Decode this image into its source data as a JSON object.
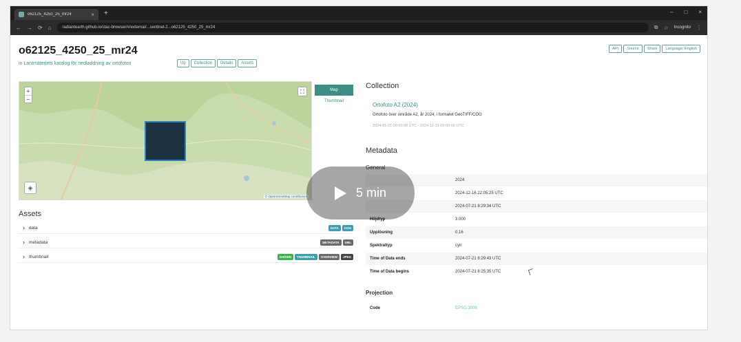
{
  "browser": {
    "tab_title": "o62125_4250_25_mr24",
    "url": "radiantearth.github.io/stac-browser/#/external/...sentinel-2...o62125_4250_25_mr24",
    "incognito_label": "Incognito"
  },
  "page": {
    "title": "o62125_4250_25_mr24",
    "subtitle": "in Lantmäteriets katalog för nedladdning av ortofoton",
    "chips": [
      "Up",
      "Collection",
      "Details",
      "Assets"
    ],
    "top_actions": [
      "API",
      "Source",
      "Share",
      "Language: English"
    ]
  },
  "map": {
    "zoom_in": "+",
    "zoom_out": "−",
    "view_tabs": [
      "Map",
      "Thumbnail"
    ],
    "attribution": "© OpenStreetMap contributors"
  },
  "assets": {
    "heading": "Assets",
    "items": [
      {
        "name": "data",
        "badges": [
          {
            "label": "DATA",
            "color": "#3d9fae"
          },
          {
            "label": "COG",
            "color": "#3d9fae"
          }
        ]
      },
      {
        "name": "metadata",
        "badges": [
          {
            "label": "METADATA",
            "color": "#6a6a6a"
          },
          {
            "label": "XML",
            "color": "#6a6a6a"
          }
        ]
      },
      {
        "name": "thumbnail",
        "badges": [
          {
            "label": "SHOWN",
            "color": "#3ab54a"
          },
          {
            "label": "THUMBNAIL",
            "color": "#3d9fae"
          },
          {
            "label": "OVERVIEW",
            "color": "#6a6a6a"
          },
          {
            "label": "JPEG",
            "color": "#444444"
          }
        ]
      }
    ]
  },
  "collection": {
    "heading": "Collection",
    "link": "Ortofoto A2 (2024)",
    "description": "Ortofoto över område A2, år 2024, i formatet GeoTIFF/COG",
    "dates": "2024-01-01 00:00:00 UTC - 2024-12-31 00:00:00 UTC"
  },
  "metadata": {
    "heading": "Metadata",
    "general": "General",
    "rows": [
      {
        "key": "",
        "value": "2024",
        "shade": true
      },
      {
        "key": "",
        "value": "2024-12-16 22:05:25 UTC",
        "shade": false
      },
      {
        "key": "",
        "value": "2024-07-21 8:29:34 UTC",
        "shade": true
      },
      {
        "key": "Höjdtyp",
        "value": "3.000",
        "shade": false
      },
      {
        "key": "Upplösning",
        "value": "0.16",
        "shade": true
      },
      {
        "key": "Spektraltyp",
        "value": "cyir",
        "shade": false
      },
      {
        "key": "Time of Data ends",
        "value": "2024-07-21 8:29:43 UTC",
        "shade": true
      },
      {
        "key": "Time of Data begins",
        "value": "2024-07-21 8:25:35 UTC",
        "shade": false
      }
    ],
    "projection_heading": "Projection",
    "code_key": "Code",
    "code_value": "EPSG:3006"
  },
  "video": {
    "duration": "5 min"
  }
}
